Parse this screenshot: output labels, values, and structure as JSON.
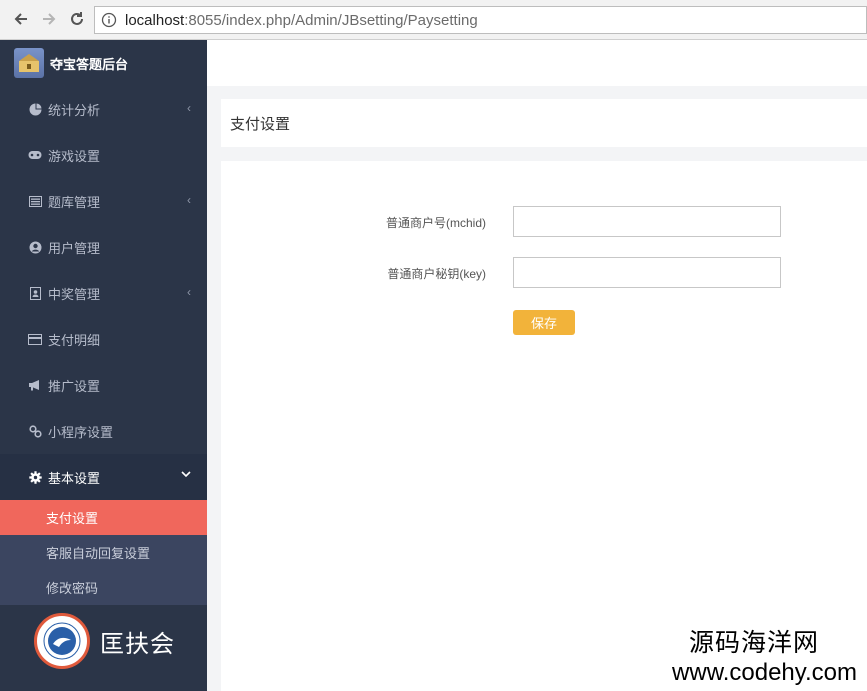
{
  "browser": {
    "url_host": "localhost",
    "url_rest": ":8055/index.php/Admin/JBsetting/Paysetting"
  },
  "sidebar": {
    "brand_title": "夺宝答题后台",
    "items": [
      {
        "label": "统计分析",
        "icon": "pie-chart-icon",
        "has_submenu": true
      },
      {
        "label": "游戏设置",
        "icon": "gamepad-icon",
        "has_submenu": false
      },
      {
        "label": "题库管理",
        "icon": "list-icon",
        "has_submenu": true
      },
      {
        "label": "用户管理",
        "icon": "user-icon",
        "has_submenu": false
      },
      {
        "label": "中奖管理",
        "icon": "contact-card-icon",
        "has_submenu": true
      },
      {
        "label": "支付明细",
        "icon": "credit-card-icon",
        "has_submenu": false
      },
      {
        "label": "推广设置",
        "icon": "megaphone-icon",
        "has_submenu": false
      },
      {
        "label": "小程序设置",
        "icon": "link-icon",
        "has_submenu": false
      },
      {
        "label": "基本设置",
        "icon": "gear-icon",
        "has_submenu": true,
        "expanded": true
      }
    ],
    "submenu": [
      {
        "label": "支付设置",
        "selected": true
      },
      {
        "label": "客服自动回复设置",
        "selected": false
      },
      {
        "label": "修改密码",
        "selected": false
      }
    ],
    "org_name": "匡扶会"
  },
  "main": {
    "panel_title": "支付设置",
    "form": {
      "mchid_label": "普通商户号(mchid)",
      "key_label": "普通商户秘钥(key)",
      "mchid_value": "",
      "key_value": "",
      "save_label": "保存"
    }
  },
  "watermark": {
    "cn": "源码海洋网",
    "en": "www.codehy.com"
  },
  "colors": {
    "sidebar_bg": "#2b3548",
    "submenu_bg": "#3b4560",
    "selected_bg": "#f0675c",
    "save_button": "#f2b33a"
  }
}
